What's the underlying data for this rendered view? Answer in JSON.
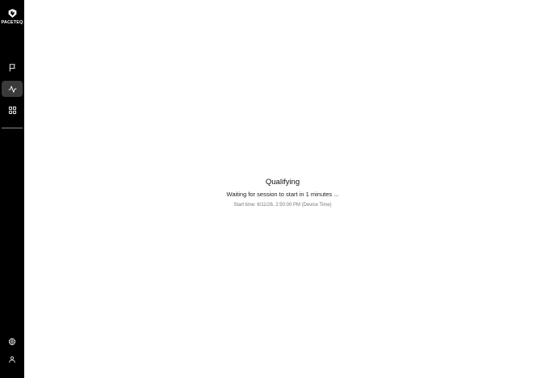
{
  "sidebar": {
    "logo_text": "PACETEQ",
    "nav": [
      {
        "id": "flag",
        "icon": "flag-icon",
        "active": false
      },
      {
        "id": "activity",
        "icon": "activity-icon",
        "active": true
      },
      {
        "id": "grid",
        "icon": "grid-icon",
        "active": false
      }
    ],
    "bottom": [
      {
        "id": "settings",
        "icon": "gear-icon"
      },
      {
        "id": "profile",
        "icon": "user-icon"
      }
    ]
  },
  "session": {
    "name": "Qualifying",
    "waiting_text": "Waiting for session to start in 1 minutes ...",
    "start_time_text": "Start time: 6/11/26, 2:50:00 PM (Device Time)"
  },
  "colors": {
    "sidebar_bg": "#000000",
    "active_nav_bg": "#3a3a3a",
    "main_bg": "#ffffff"
  }
}
